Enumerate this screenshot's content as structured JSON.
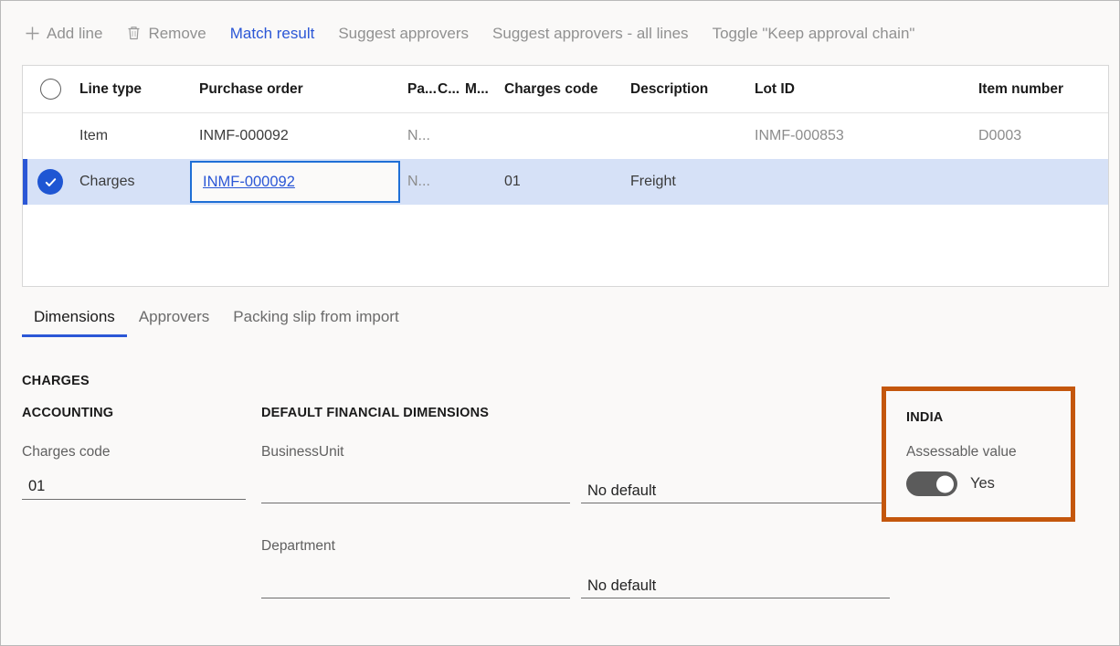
{
  "toolbar": {
    "buttons": [
      {
        "label": "Add line",
        "icon": "plus-icon",
        "accent": false
      },
      {
        "label": "Remove",
        "icon": "trash-icon",
        "accent": false
      },
      {
        "label": "Match result",
        "icon": null,
        "accent": true
      },
      {
        "label": "Suggest approvers",
        "icon": null,
        "accent": false
      },
      {
        "label": "Suggest approvers - all lines",
        "icon": null,
        "accent": false
      },
      {
        "label": "Toggle \"Keep approval chain\"",
        "icon": null,
        "accent": false
      }
    ]
  },
  "grid": {
    "columns": [
      "Line type",
      "Purchase order",
      "Pa...",
      "C...",
      "M...",
      "Charges code",
      "Description",
      "Lot ID",
      "Item number"
    ],
    "rows": [
      {
        "selected": false,
        "line_type": "Item",
        "purchase_order": "INMF-000092",
        "pa": "N...",
        "c": "",
        "m": "",
        "charges_code": "",
        "description": "",
        "lot_id": "INMF-000853",
        "item_number": "D0003"
      },
      {
        "selected": true,
        "line_type": "Charges",
        "purchase_order": "INMF-000092",
        "pa": "N...",
        "c": "",
        "m": "",
        "charges_code": "01",
        "description": "Freight",
        "lot_id": "",
        "item_number": ""
      }
    ]
  },
  "tabs": [
    {
      "label": "Dimensions",
      "active": true
    },
    {
      "label": "Approvers",
      "active": false
    },
    {
      "label": "Packing slip from import",
      "active": false
    }
  ],
  "detail": {
    "charges_title": "CHARGES",
    "accounting_title": "ACCOUNTING",
    "charges_code_label": "Charges code",
    "charges_code_value": "01",
    "dimensions_title": "DEFAULT FINANCIAL DIMENSIONS",
    "business_unit_label": "BusinessUnit",
    "business_unit_value": "",
    "business_unit_default": "No default",
    "department_label": "Department",
    "department_value": "",
    "department_default": "No default"
  },
  "india": {
    "title": "INDIA",
    "assessable_value_label": "Assessable value",
    "assessable_value_state": "Yes",
    "highlight_color": "#c4570d",
    "toggle_on": true
  },
  "colors": {
    "accent_blue": "#2b57d6",
    "selected_row": "#d6e1f7",
    "page_background": "#faf9f8",
    "highlight_orange": "#c4570d",
    "toggle_track": "#5b5b5b"
  }
}
